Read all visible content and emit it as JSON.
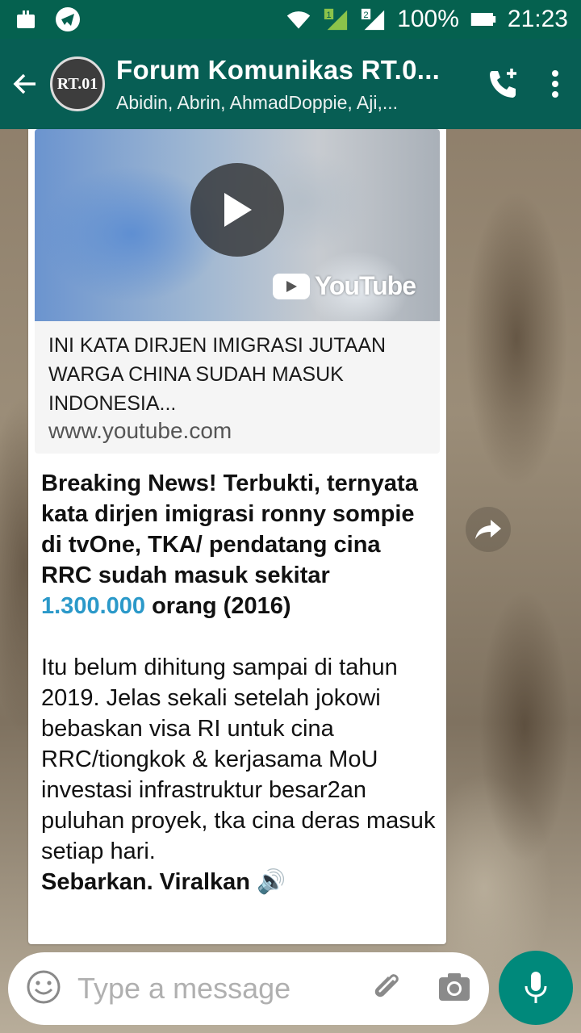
{
  "status_bar": {
    "battery": "100%",
    "time": "21:23",
    "sim1": "1",
    "sim2": "2"
  },
  "header": {
    "title": "Forum Komunikas RT.0...",
    "subtitle": "Abidin, Abrin, AhmadDoppie, Aji,...",
    "avatar_text": "RT.01"
  },
  "link_preview": {
    "title": "INI KATA DIRJEN IMIGRASI JUTAAN WARGA CHINA SUDAH MASUK INDONESIA...",
    "url": "www.youtube.com",
    "brand": "YouTube"
  },
  "message": {
    "bold_part1": "Breaking News! Terbukti, ternyata kata dirjen imigrasi ronny sompie di tvOne, TKA/ pendatang cina RRC sudah masuk sekitar ",
    "highlight_number": "1.300.000",
    "bold_part2": " orang (2016)",
    "body": "Itu belum dihitung sampai di tahun 2019. Jelas sekali setelah jokowi bebaskan visa RI untuk cina RRC/tiongkok & kerjasama MoU investasi infrastruktur besar2an puluhan proyek, tka cina deras masuk setiap hari.",
    "closing": "Sebarkan. Viralkan",
    "closing_emoji": "🔊"
  },
  "input": {
    "placeholder": "Type a message"
  },
  "colors": {
    "header": "#075e54",
    "status_bar": "#05614f",
    "accent": "#00897b",
    "link": "#2b99c9"
  }
}
